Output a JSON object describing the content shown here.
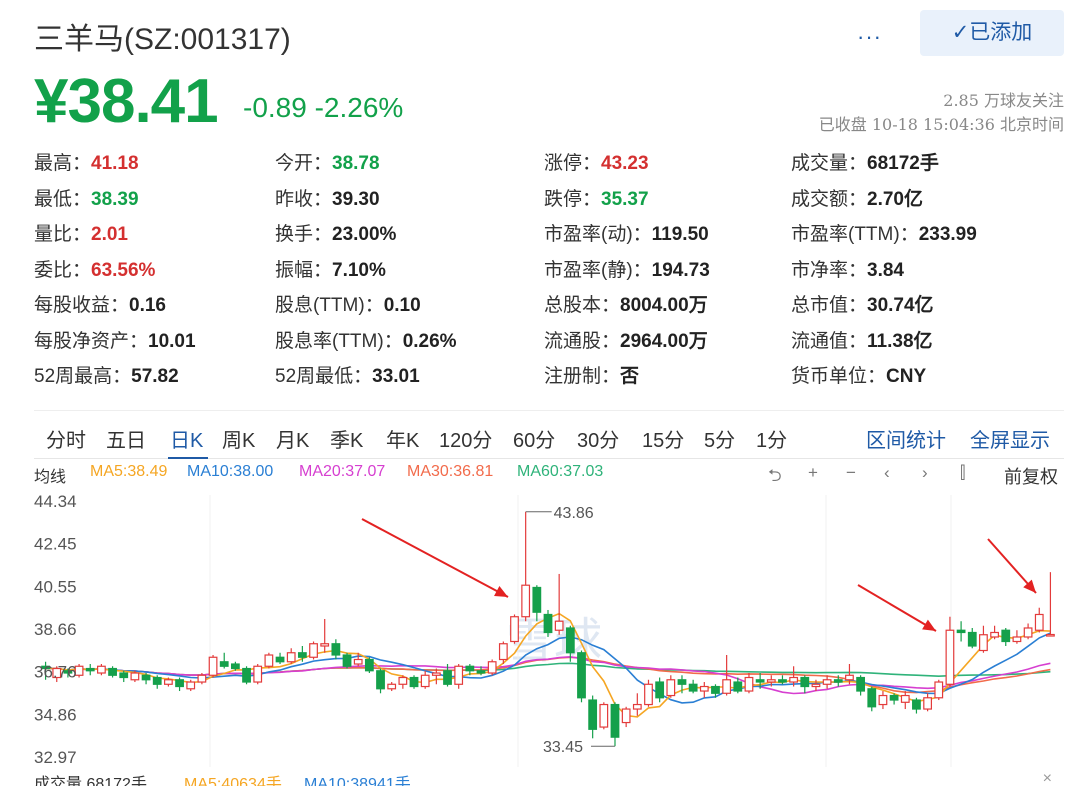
{
  "header": {
    "title": "三羊马(SZ:001317)",
    "more_label": "···",
    "added_label": "✓已添加"
  },
  "price": {
    "current": "¥38.41",
    "change": "-0.89  -2.26%",
    "followers": "2.85 万球友关注",
    "close_time": "已收盘 10-18 15:04:36 北京时间"
  },
  "quote_rows": [
    [
      {
        "label": "最高：",
        "value": "41.18",
        "color": "red"
      },
      {
        "label": "今开：",
        "value": "38.78",
        "color": "green"
      },
      {
        "label": "涨停：",
        "value": "43.23",
        "color": "red"
      },
      {
        "label": "成交量：",
        "value": "68172手",
        "color": ""
      }
    ],
    [
      {
        "label": "最低：",
        "value": "38.39",
        "color": "green"
      },
      {
        "label": "昨收：",
        "value": "39.30",
        "color": ""
      },
      {
        "label": "跌停：",
        "value": "35.37",
        "color": "green"
      },
      {
        "label": "成交额：",
        "value": "2.70亿",
        "color": ""
      }
    ],
    [
      {
        "label": "量比：",
        "value": "2.01",
        "color": "red"
      },
      {
        "label": "换手：",
        "value": "23.00%",
        "color": ""
      },
      {
        "label": "市盈率(动)：",
        "value": "119.50",
        "color": ""
      },
      {
        "label": "市盈率(TTM)：",
        "value": "233.99",
        "color": ""
      }
    ],
    [
      {
        "label": "委比：",
        "value": "63.56%",
        "color": "red"
      },
      {
        "label": "振幅：",
        "value": "7.10%",
        "color": ""
      },
      {
        "label": "市盈率(静)：",
        "value": "194.73",
        "color": ""
      },
      {
        "label": "市净率：",
        "value": "3.84",
        "color": ""
      }
    ],
    [
      {
        "label": "每股收益：",
        "value": "0.16",
        "color": ""
      },
      {
        "label": "股息(TTM)：",
        "value": "0.10",
        "color": ""
      },
      {
        "label": "总股本：",
        "value": "8004.00万",
        "color": ""
      },
      {
        "label": "总市值：",
        "value": "30.74亿",
        "color": ""
      }
    ],
    [
      {
        "label": "每股净资产：",
        "value": "10.01",
        "color": ""
      },
      {
        "label": "股息率(TTM)：",
        "value": "0.26%",
        "color": ""
      },
      {
        "label": "流通股：",
        "value": "2964.00万",
        "color": ""
      },
      {
        "label": "流通值：",
        "value": "11.38亿",
        "color": ""
      }
    ],
    [
      {
        "label": "52周最高：",
        "value": "57.82",
        "color": ""
      },
      {
        "label": "52周最低：",
        "value": "33.01",
        "color": ""
      },
      {
        "label": "注册制：",
        "value": "否",
        "color": ""
      },
      {
        "label": "货币单位：",
        "value": "CNY",
        "color": ""
      }
    ]
  ],
  "tabs": [
    "分时",
    "五日",
    "日K",
    "周K",
    "月K",
    "季K",
    "年K",
    "120分",
    "60分",
    "30分",
    "15分",
    "5分",
    "1分"
  ],
  "active_tab": "日K",
  "tab_links": [
    "区间统计",
    "全屏显示"
  ],
  "ma_row": {
    "label": "均线",
    "items": [
      {
        "text": "MA5:38.49",
        "color": "#f5a623"
      },
      {
        "text": "MA10:38.00",
        "color": "#2a7fd4"
      },
      {
        "text": "MA20:37.07",
        "color": "#d63fd0"
      },
      {
        "text": "MA30:36.81",
        "color": "#f26b4b"
      },
      {
        "text": "MA60:37.03",
        "color": "#2fb37a"
      }
    ],
    "controls": [
      "⮌",
      "+",
      "−",
      "‹",
      "›",
      "⫿"
    ],
    "fuquan": "前复权"
  },
  "volume_row": {
    "text": "成交量 68172手",
    "ma5": "MA5:40634手",
    "ma10": "MA10:38941手",
    "close": "×"
  },
  "colors": {
    "up": "#e33b3b",
    "down": "#15a04b",
    "accent": "#1f5aa6"
  },
  "chart_data": {
    "type": "candlestick",
    "yticks": [
      "44.34",
      "42.45",
      "40.55",
      "38.66",
      "36.76",
      "34.86",
      "32.97"
    ],
    "ylim": [
      32.97,
      44.34
    ],
    "annotations": {
      "high": "43.86",
      "low": "33.45"
    },
    "watermark": "雪球",
    "candles": [
      [
        37.0,
        36.9,
        37.2,
        36.4
      ],
      [
        36.5,
        36.9,
        37.0,
        36.3
      ],
      [
        36.8,
        36.7,
        36.9,
        36.5
      ],
      [
        36.6,
        37.0,
        37.1,
        36.5
      ],
      [
        36.9,
        36.8,
        37.1,
        36.6
      ],
      [
        36.7,
        37.0,
        37.1,
        36.6
      ],
      [
        36.9,
        36.6,
        37.0,
        36.5
      ],
      [
        36.7,
        36.5,
        36.8,
        36.3
      ],
      [
        36.4,
        36.7,
        36.8,
        36.3
      ],
      [
        36.6,
        36.4,
        36.7,
        36.2
      ],
      [
        36.5,
        36.2,
        36.6,
        36.0
      ],
      [
        36.2,
        36.4,
        36.5,
        36.1
      ],
      [
        36.4,
        36.1,
        36.5,
        35.9
      ],
      [
        36.0,
        36.3,
        36.4,
        35.9
      ],
      [
        36.3,
        36.6,
        36.7,
        36.2
      ],
      [
        36.6,
        37.4,
        37.5,
        36.5
      ],
      [
        37.2,
        37.0,
        37.6,
        36.9
      ],
      [
        37.1,
        36.9,
        37.2,
        36.8
      ],
      [
        36.9,
        36.3,
        37.0,
        36.2
      ],
      [
        36.3,
        37.0,
        37.1,
        36.2
      ],
      [
        37.0,
        37.5,
        37.6,
        36.9
      ],
      [
        37.4,
        37.2,
        37.6,
        37.1
      ],
      [
        37.2,
        37.6,
        37.8,
        37.1
      ],
      [
        37.6,
        37.4,
        37.9,
        37.2
      ],
      [
        37.4,
        38.0,
        38.1,
        37.3
      ],
      [
        37.9,
        38.0,
        39.1,
        37.6
      ],
      [
        38.0,
        37.5,
        38.2,
        37.3
      ],
      [
        37.5,
        37.0,
        37.6,
        36.9
      ],
      [
        37.1,
        37.3,
        37.6,
        37.0
      ],
      [
        37.3,
        36.8,
        37.4,
        36.7
      ],
      [
        36.8,
        36.0,
        36.9,
        35.8
      ],
      [
        36.0,
        36.2,
        36.3,
        35.9
      ],
      [
        36.2,
        36.5,
        36.6,
        36.0
      ],
      [
        36.5,
        36.1,
        36.6,
        36.0
      ],
      [
        36.1,
        36.6,
        36.8,
        36.0
      ],
      [
        36.6,
        36.7,
        36.9,
        36.2
      ],
      [
        36.8,
        36.2,
        37.1,
        36.1
      ],
      [
        36.2,
        37.0,
        37.1,
        36.0
      ],
      [
        37.0,
        36.8,
        37.1,
        36.6
      ],
      [
        36.8,
        36.7,
        37.0,
        36.6
      ],
      [
        36.7,
        37.2,
        37.3,
        36.6
      ],
      [
        37.3,
        38.0,
        38.1,
        37.1
      ],
      [
        38.1,
        39.2,
        39.3,
        38.0
      ],
      [
        39.2,
        40.6,
        43.86,
        39.0
      ],
      [
        40.5,
        39.4,
        40.6,
        39.0
      ],
      [
        39.3,
        38.5,
        39.5,
        38.3
      ],
      [
        38.6,
        39.0,
        41.1,
        38.4
      ],
      [
        38.7,
        37.6,
        38.8,
        37.2
      ],
      [
        37.6,
        35.6,
        37.7,
        35.4
      ],
      [
        35.5,
        34.2,
        35.7,
        33.8
      ],
      [
        34.3,
        35.3,
        35.4,
        34.2
      ],
      [
        35.3,
        33.85,
        35.4,
        33.45
      ],
      [
        34.5,
        35.1,
        35.2,
        34.3
      ],
      [
        35.1,
        35.3,
        35.8,
        34.8
      ],
      [
        35.3,
        36.2,
        36.4,
        35.2
      ],
      [
        36.3,
        35.6,
        36.5,
        35.4
      ],
      [
        35.7,
        36.4,
        36.6,
        35.6
      ],
      [
        36.4,
        36.2,
        36.6,
        35.8
      ],
      [
        36.2,
        35.9,
        36.4,
        35.8
      ],
      [
        35.9,
        36.1,
        36.3,
        35.6
      ],
      [
        36.1,
        35.8,
        36.2,
        35.6
      ],
      [
        35.8,
        36.4,
        37.5,
        35.7
      ],
      [
        36.3,
        35.9,
        36.5,
        35.8
      ],
      [
        35.9,
        36.5,
        36.7,
        35.8
      ],
      [
        36.4,
        36.3,
        36.7,
        36.0
      ],
      [
        36.3,
        36.4,
        36.6,
        36.1
      ],
      [
        36.4,
        36.3,
        36.6,
        36.2
      ],
      [
        36.3,
        36.5,
        37.0,
        36.1
      ],
      [
        36.5,
        36.1,
        36.6,
        35.8
      ],
      [
        36.1,
        36.2,
        36.4,
        35.9
      ],
      [
        36.2,
        36.4,
        36.6,
        36.0
      ],
      [
        36.4,
        36.3,
        36.6,
        36.1
      ],
      [
        36.4,
        36.6,
        37.1,
        36.2
      ],
      [
        36.5,
        35.9,
        36.6,
        35.7
      ],
      [
        36.0,
        35.2,
        36.1,
        35.0
      ],
      [
        35.3,
        35.7,
        35.9,
        35.1
      ],
      [
        35.7,
        35.5,
        35.8,
        35.3
      ],
      [
        35.4,
        35.7,
        35.9,
        35.1
      ],
      [
        35.5,
        35.1,
        35.6,
        34.9
      ],
      [
        35.1,
        35.6,
        35.8,
        35.0
      ],
      [
        35.6,
        36.3,
        36.4,
        35.5
      ],
      [
        36.2,
        38.6,
        39.2,
        36.1
      ],
      [
        38.6,
        38.5,
        39.0,
        38.1
      ],
      [
        38.5,
        37.9,
        38.7,
        37.8
      ],
      [
        37.7,
        38.4,
        38.8,
        37.6
      ],
      [
        38.3,
        38.5,
        38.8,
        38.2
      ],
      [
        38.6,
        38.1,
        38.7,
        37.9
      ],
      [
        38.1,
        38.3,
        38.6,
        38.0
      ],
      [
        38.3,
        38.7,
        38.9,
        38.2
      ],
      [
        38.6,
        39.3,
        39.6,
        38.5
      ],
      [
        38.41,
        38.41,
        41.18,
        38.39
      ]
    ]
  }
}
